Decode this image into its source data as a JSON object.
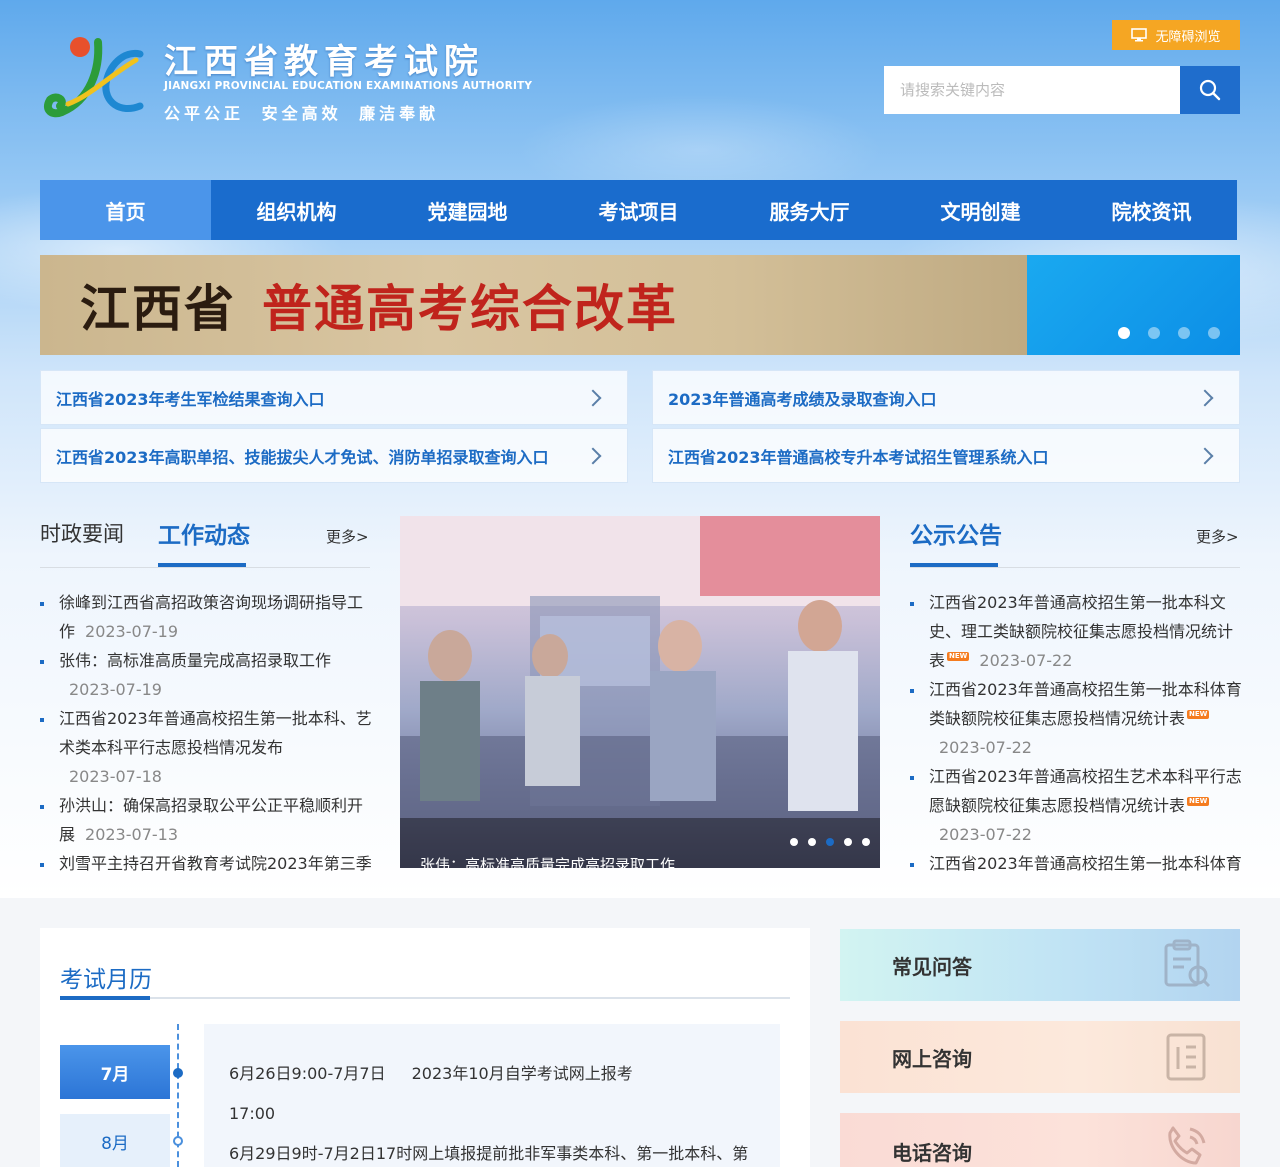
{
  "header": {
    "title": "江西省教育考试院",
    "subtitle_en": "JIANGXI PROVINCIAL EDUCATION EXAMINATIONS AUTHORITY",
    "motto": "公平公正 安全高效 廉洁奉献",
    "accessibility_label": "无障碍浏览",
    "search_placeholder": "请搜索关键内容"
  },
  "nav": {
    "items": [
      "首页",
      "组织机构",
      "党建园地",
      "考试项目",
      "服务大厅",
      "文明创建",
      "院校资讯"
    ],
    "active_index": 0
  },
  "banner": {
    "text_left": "江西省",
    "text_right": "普通高考综合改革",
    "slide_count": 4,
    "active_slide": 0
  },
  "quick_links": [
    "江西省2023年考生军检结果查询入口",
    "2023年普通高考成绩及录取查询入口",
    "江西省2023年高职单招、技能拔尖人才免试、消防单招录取查询入口",
    "江西省2023年普通高校专升本考试招生管理系统入口"
  ],
  "news": {
    "tab_inactive": "时政要闻",
    "tab_active": "工作动态",
    "more_label": "更多>",
    "items": [
      {
        "title": "徐峰到江西省高招政策咨询现场调研指导工作",
        "date": "2023-07-19"
      },
      {
        "title": "张伟：高标准高质量完成高招录取工作",
        "date": "2023-07-19"
      },
      {
        "title": "江西省2023年普通高校招生第一批本科、艺术类本科平行志愿投档情况发布",
        "date": "2023-07-18"
      },
      {
        "title": "孙洪山：确保高招录取公平公正平稳顺利开展",
        "date": "2023-07-13"
      },
      {
        "title": "刘雪平主持召开省教育考试院2023年第三季",
        "date": ""
      }
    ]
  },
  "photo": {
    "caption": "张伟：高标准高质量完成高招录取工作",
    "dot_count": 5,
    "active_dot": 2
  },
  "notices": {
    "title": "公示公告",
    "more_label": "更多>",
    "new_label": "NEW",
    "items": [
      {
        "title": "江西省2023年普通高校招生第一批本科文史、理工类缺额院校征集志愿投档情况统计表",
        "date": "2023-07-22",
        "is_new": true
      },
      {
        "title": "江西省2023年普通高校招生第一批本科体育类缺额院校征集志愿投档情况统计表",
        "date": "2023-07-22",
        "is_new": true
      },
      {
        "title": "江西省2023年普通高校招生艺术本科平行志愿缺额院校征集志愿投档情况统计表",
        "date": "2023-07-22",
        "is_new": true
      },
      {
        "title": "江西省2023年普通高校招生第一批本科体育",
        "date": "",
        "is_new": false
      }
    ]
  },
  "calendar": {
    "title": "考试月历",
    "months": [
      "7月",
      "8月"
    ],
    "active_month": 0,
    "events": [
      {
        "time": "6月26日9:00-7月7日",
        "desc": "2023年10月自学考试网上报考"
      },
      {
        "time": "17:00",
        "desc": ""
      },
      {
        "time": "6月29日9时-7月2日17时",
        "desc": "网上填报提前批非军事类本科、第一批本科、第"
      }
    ]
  },
  "services": [
    {
      "label": "常见问答",
      "icon": "faq-icon"
    },
    {
      "label": "网上咨询",
      "icon": "document-icon"
    },
    {
      "label": "电话咨询",
      "icon": "phone-icon"
    }
  ],
  "colors": {
    "primary": "#1c6bc4",
    "nav_bg": "#1a6ccd",
    "nav_active": "#4b95ea",
    "accessibility": "#f5a623",
    "new_badge": "#f57c1f"
  }
}
